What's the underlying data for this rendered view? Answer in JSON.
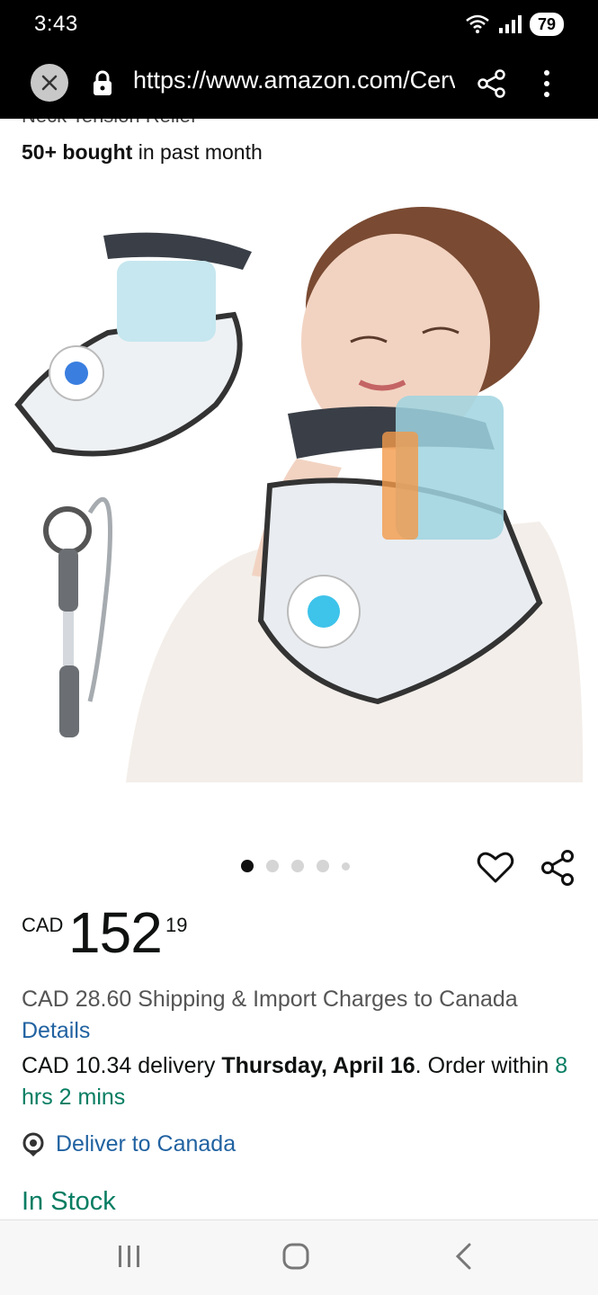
{
  "status_bar": {
    "time": "3:43",
    "battery": "79"
  },
  "browser": {
    "url": "https://www.amazon.com/Cervical-Neck-Traction-Device"
  },
  "product": {
    "title_cut": "Neck Tension Relief",
    "bought_bold": "50+ bought",
    "bought_rest": " in past month",
    "price": {
      "currency": "CAD",
      "whole": "152",
      "fraction": "19"
    },
    "shipping_text": "CAD 28.60 Shipping & Import Charges to Canada",
    "details_link": "Details",
    "delivery_prefix": "CAD 10.34 delivery ",
    "delivery_date": "Thursday, April 16",
    "delivery_mid": ". Order within ",
    "delivery_countdown": "8 hrs 2 mins",
    "deliver_to": "Deliver to Canada",
    "stock": "In Stock"
  },
  "carousel": {
    "count": 5,
    "active": 0
  },
  "colors": {
    "link": "#2162a1",
    "green": "#067d62",
    "text": "#0f1111"
  }
}
